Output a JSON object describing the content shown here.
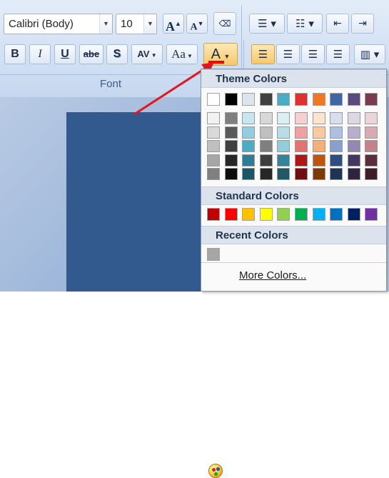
{
  "font_group": {
    "font_name": "Calibri (Body)",
    "font_size": "10",
    "group_label": "Font",
    "grow_font_label": "A",
    "shrink_font_label": "A",
    "bold_label": "B",
    "italic_label": "I",
    "underline_label": "U",
    "strikethrough_label": "abe",
    "shadow_label": "S",
    "char_spacing_label": "AV",
    "change_case_label": "Aa",
    "font_color_label": "A",
    "font_color_current": "#ff0000"
  },
  "palette": {
    "theme_header": "Theme Colors",
    "standard_header": "Standard Colors",
    "recent_header": "Recent Colors",
    "more_colors_label": "More Colors...",
    "theme_top": [
      "#ffffff",
      "#000000",
      "#dde4ee",
      "#404040",
      "#4bacc6",
      "#e03030",
      "#f07820",
      "#4066a8",
      "#5a4a80",
      "#7a3a50"
    ],
    "theme_shades": [
      [
        "#f2f2f2",
        "#d9d9d9",
        "#bfbfbf",
        "#a6a6a6",
        "#808080"
      ],
      [
        "#7f7f7f",
        "#595959",
        "#404040",
        "#262626",
        "#0d0d0d"
      ],
      [
        "#c6e6f2",
        "#92cde2",
        "#4bacc6",
        "#2e7d96",
        "#1c5567"
      ],
      [
        "#d8d8d8",
        "#bfbfbf",
        "#7f7f7f",
        "#3f3f3f",
        "#262626"
      ],
      [
        "#daeef3",
        "#b6dde8",
        "#92cddc",
        "#31849b",
        "#205867"
      ],
      [
        "#f6d0d0",
        "#eda1a1",
        "#e37272",
        "#b01818",
        "#700f0f"
      ],
      [
        "#fde4d0",
        "#fbc9a1",
        "#f9ae73",
        "#c05608",
        "#7f3905"
      ],
      [
        "#d6dff0",
        "#aebfe0",
        "#86a0d1",
        "#2f4d80",
        "#1f3356"
      ],
      [
        "#dbd7e5",
        "#b7afcc",
        "#9388b2",
        "#433660",
        "#2d2440"
      ],
      [
        "#ecd5d8",
        "#d8abb2",
        "#c5828b",
        "#5c2c3a",
        "#3d1d27"
      ]
    ],
    "standard": [
      "#c00000",
      "#ff0000",
      "#ffc000",
      "#ffff00",
      "#92d050",
      "#00b050",
      "#00b0f0",
      "#0070c0",
      "#002060",
      "#7030a0"
    ],
    "recent": [
      "#a6a6a6"
    ]
  }
}
